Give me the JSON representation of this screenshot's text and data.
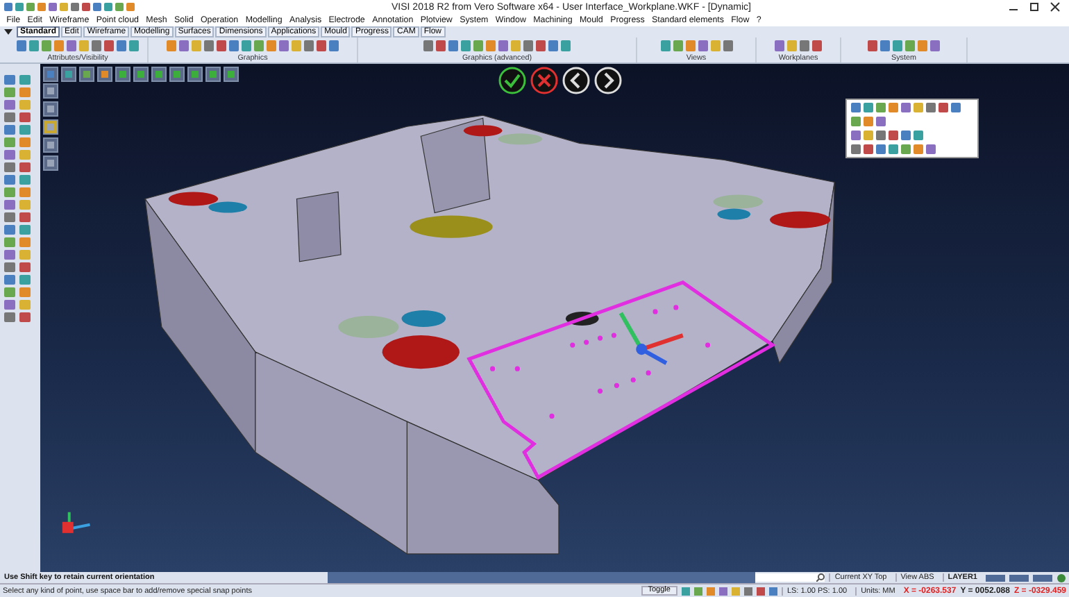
{
  "window": {
    "title": "VISI 2018 R2 from Vero Software x64 - User Interface_Workplane.WKF - [Dynamic]"
  },
  "menu": [
    "File",
    "Edit",
    "Wireframe",
    "Point cloud",
    "Mesh",
    "Solid",
    "Operation",
    "Modelling",
    "Analysis",
    "Electrode",
    "Annotation",
    "Plotview",
    "System",
    "Window",
    "Machining",
    "Mould",
    "Progress",
    "Standard elements",
    "Flow",
    "?"
  ],
  "ribbon_tabs": [
    {
      "label": "Standard",
      "selected": true
    },
    {
      "label": "Edit",
      "selected": false
    },
    {
      "label": "Wireframe",
      "selected": false
    },
    {
      "label": "Modelling",
      "selected": false
    },
    {
      "label": "Surfaces",
      "selected": false
    },
    {
      "label": "Dimensions",
      "selected": false
    },
    {
      "label": "Applications",
      "selected": false
    },
    {
      "label": "Mould",
      "selected": false
    },
    {
      "label": "Progress",
      "selected": false
    },
    {
      "label": "CAM",
      "selected": false
    },
    {
      "label": "Flow",
      "selected": false
    }
  ],
  "ribbon_groups": [
    "Attributes/Visibility",
    "Graphics",
    "Graphics (advanced)",
    "Views",
    "Workplanes",
    "System"
  ],
  "prompt": {
    "message": "Use Shift key to retain current orientation",
    "hint": "Select any kind of point, use space bar to add/remove special snap points"
  },
  "status": {
    "view_label": "Current XY Top",
    "view_mode": "View ABS",
    "layer": "LAYER1",
    "toggle": "Toggle",
    "scale": "LS: 1.00 PS: 1.00",
    "units": "Units: MM",
    "coordinates": [
      {
        "text": "X = -0263.537",
        "color": "#e02020"
      },
      {
        "text": "Y = 0052.088",
        "color": "#202020"
      },
      {
        "text": "Z = -0329.459",
        "color": "#e02020"
      }
    ]
  }
}
